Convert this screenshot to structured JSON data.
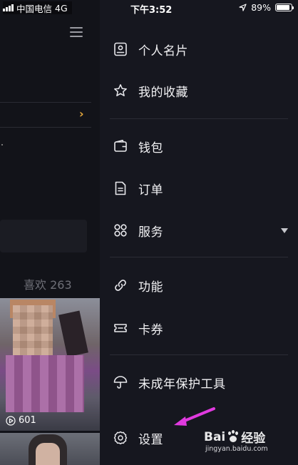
{
  "status_bar": {
    "carrier": "中国电信",
    "network": "4G",
    "time": "下午3:52",
    "battery": "89%",
    "battery_level": 0.89
  },
  "background_page": {
    "likes_label": "喜欢 263",
    "play_count": "601"
  },
  "drawer": {
    "items": [
      {
        "label": "个人名片",
        "icon": "profile-card-icon"
      },
      {
        "label": "我的收藏",
        "icon": "star-icon"
      },
      {
        "label": "钱包",
        "icon": "wallet-icon"
      },
      {
        "label": "订单",
        "icon": "order-document-icon"
      },
      {
        "label": "服务",
        "icon": "services-grid-icon"
      },
      {
        "label": "功能",
        "icon": "link-icon"
      },
      {
        "label": "卡券",
        "icon": "ticket-icon"
      },
      {
        "label": "未成年保护工具",
        "icon": "umbrella-icon"
      },
      {
        "label": "设置",
        "icon": "gear-icon"
      }
    ]
  },
  "watermark": {
    "brand_left": "Bai",
    "brand_right": "经验",
    "url": "jingyan.baidu.com"
  },
  "colors": {
    "drawer_bg": "#16171f",
    "accent_chevron": "#e7a93c",
    "annotation_arrow": "#e03adf"
  }
}
